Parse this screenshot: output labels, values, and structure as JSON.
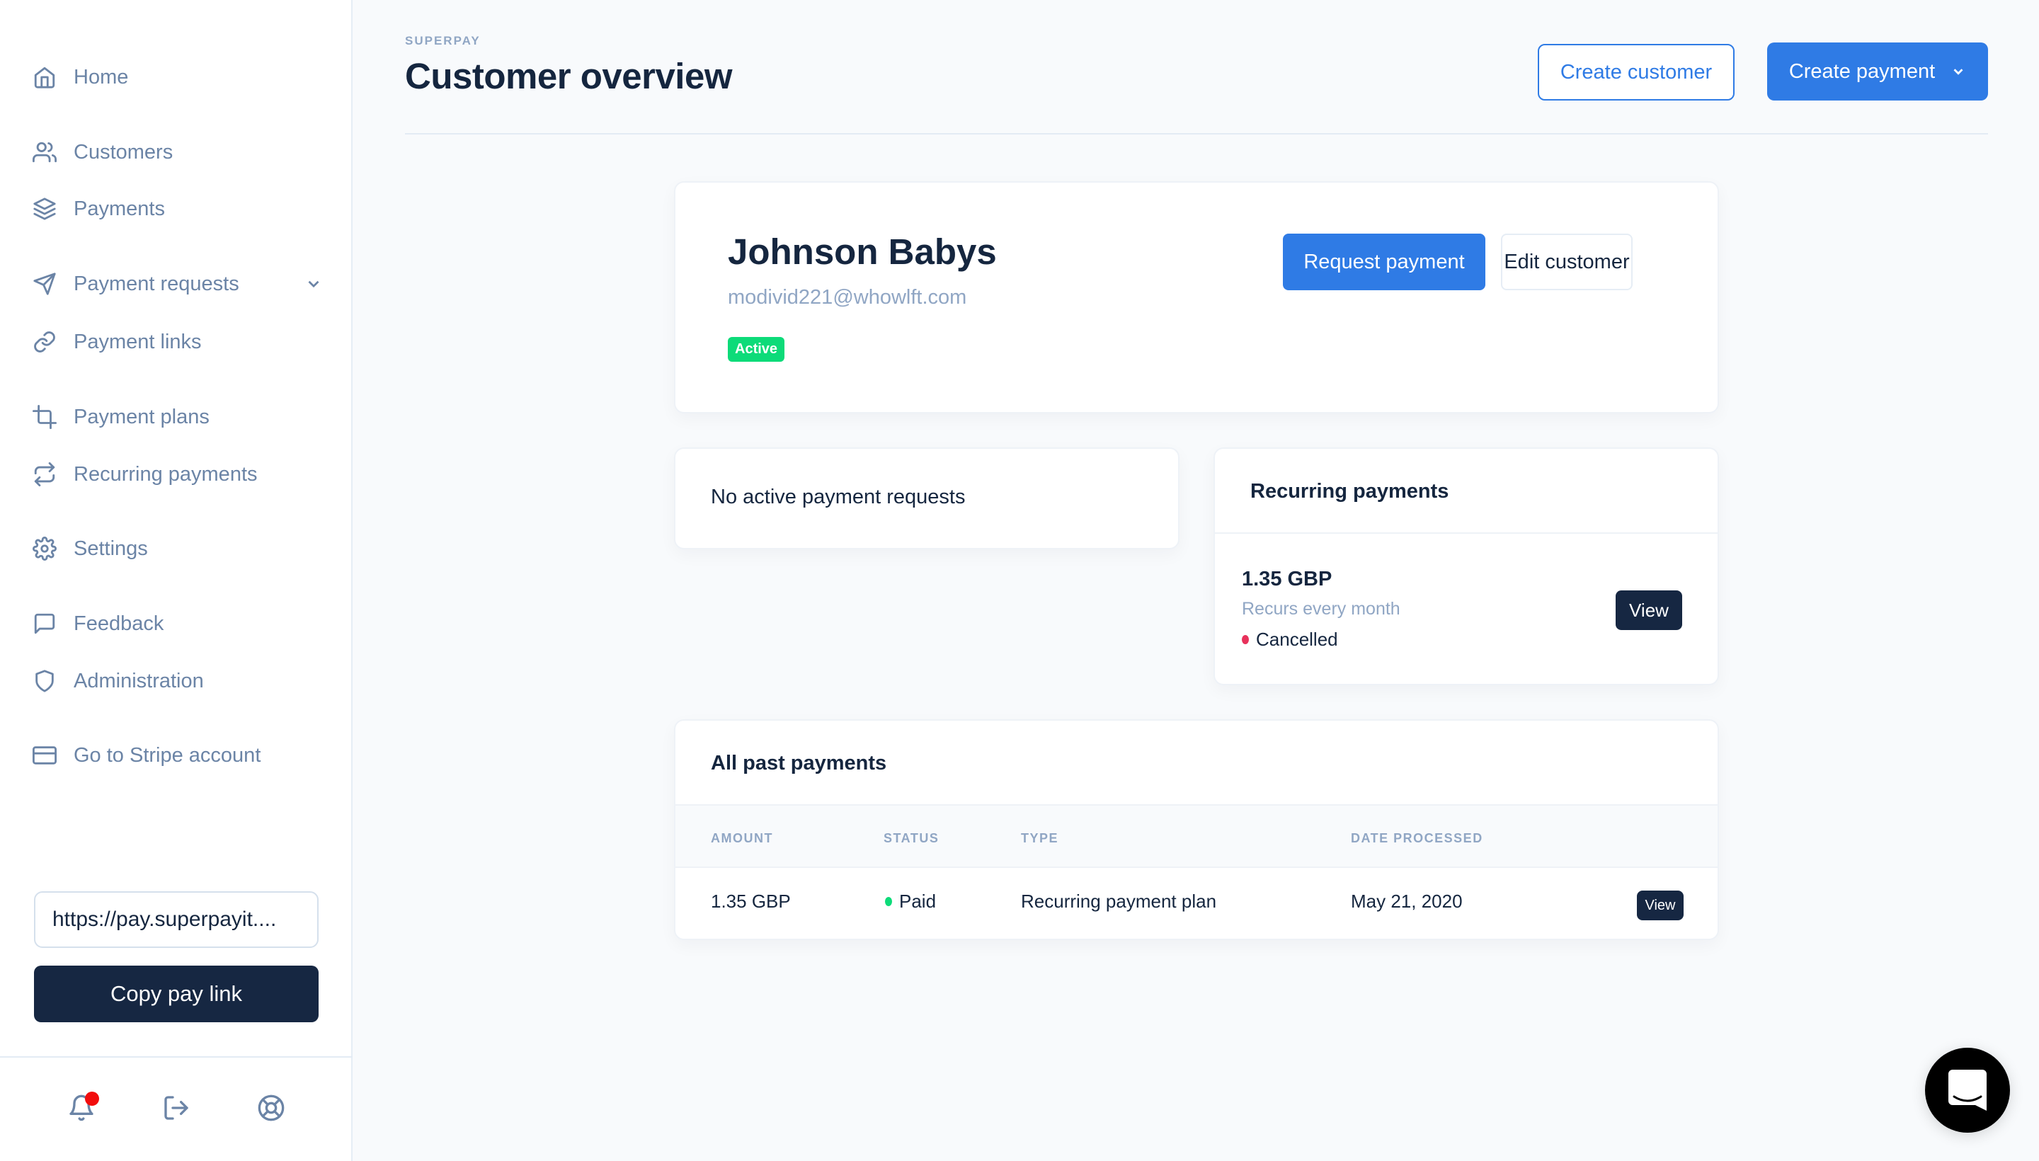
{
  "sidebar": {
    "items": [
      {
        "label": "Home",
        "icon": "home-icon"
      },
      {
        "label": "Customers",
        "icon": "users-icon"
      },
      {
        "label": "Payments",
        "icon": "layers-icon"
      },
      {
        "label": "Payment requests",
        "icon": "send-icon",
        "expandable": true
      },
      {
        "label": "Payment links",
        "icon": "link-icon"
      },
      {
        "label": "Payment plans",
        "icon": "crop-icon"
      },
      {
        "label": "Recurring payments",
        "icon": "repeat-icon"
      },
      {
        "label": "Settings",
        "icon": "gear-icon"
      },
      {
        "label": "Feedback",
        "icon": "message-square-icon"
      },
      {
        "label": "Administration",
        "icon": "shield-icon"
      },
      {
        "label": "Go to Stripe account",
        "icon": "credit-card-icon"
      }
    ],
    "pay_link_value": "https://pay.superpayit....",
    "copy_button": "Copy pay link",
    "footer_icons": [
      "bell-icon",
      "logout-icon",
      "lifebuoy-icon"
    ],
    "notification_dot_color": "#f20d0d"
  },
  "header": {
    "brand": "SUPERPAY",
    "title": "Customer overview",
    "create_customer": "Create customer",
    "create_payment": "Create payment"
  },
  "customer": {
    "name": "Johnson Babys",
    "email": "modivid221@whowlft.com",
    "status": "Active",
    "request_payment": "Request payment",
    "edit_customer": "Edit customer"
  },
  "payment_requests": {
    "empty_text": "No active payment requests"
  },
  "recurring": {
    "title": "Recurring payments",
    "amount": "1.35 GBP",
    "schedule": "Recurs every month",
    "status": "Cancelled",
    "status_color": "#e8315b",
    "view": "View"
  },
  "past_payments": {
    "title": "All past payments",
    "columns": [
      "AMOUNT",
      "STATUS",
      "TYPE",
      "DATE PROCESSED"
    ],
    "rows": [
      {
        "amount": "1.35 GBP",
        "status": "Paid",
        "status_color": "#0ddb79",
        "type": "Recurring payment plan",
        "date": "May 21, 2020",
        "action": "View"
      }
    ]
  },
  "colors": {
    "accent": "#2f7be5",
    "dark": "#162742",
    "muted": "#6b84a6",
    "success": "#0ddb79"
  }
}
